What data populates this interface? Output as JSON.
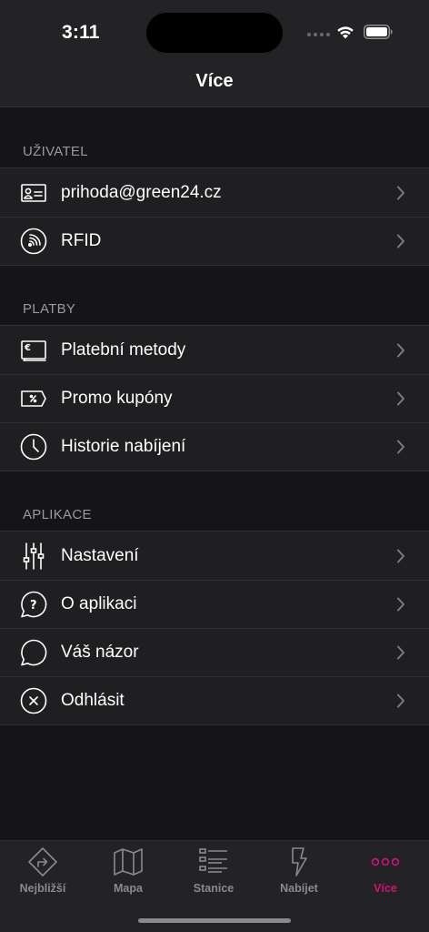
{
  "status_bar": {
    "time": "3:11"
  },
  "header": {
    "title": "Více"
  },
  "sections": [
    {
      "title": "UŽIVATEL",
      "items": [
        {
          "label": "prihoda@green24.cz",
          "icon": "id-card-icon"
        },
        {
          "label": "RFID",
          "icon": "rfid-icon"
        }
      ]
    },
    {
      "title": "PLATBY",
      "items": [
        {
          "label": "Platební metody",
          "icon": "euro-card-icon"
        },
        {
          "label": "Promo kupóny",
          "icon": "coupon-icon"
        },
        {
          "label": "Historie nabíjení",
          "icon": "clock-icon"
        }
      ]
    },
    {
      "title": "APLIKACE",
      "items": [
        {
          "label": "Nastavení",
          "icon": "sliders-icon"
        },
        {
          "label": "O aplikaci",
          "icon": "question-bubble-icon"
        },
        {
          "label": "Váš názor",
          "icon": "chat-bubble-icon"
        },
        {
          "label": "Odhlásit",
          "icon": "logout-x-icon"
        }
      ]
    }
  ],
  "tabbar": {
    "tabs": [
      {
        "label": "Nejbližší",
        "icon": "directions-icon"
      },
      {
        "label": "Mapa",
        "icon": "map-icon"
      },
      {
        "label": "Stanice",
        "icon": "list-icon"
      },
      {
        "label": "Nabíjet",
        "icon": "bolt-icon"
      },
      {
        "label": "Více",
        "icon": "more-dots-icon"
      }
    ],
    "active_index": 4
  },
  "colors": {
    "accent": "#d1127b",
    "background": "#151517",
    "cell": "#1f1f21",
    "bar": "#232325",
    "muted": "#8a8a8e"
  }
}
